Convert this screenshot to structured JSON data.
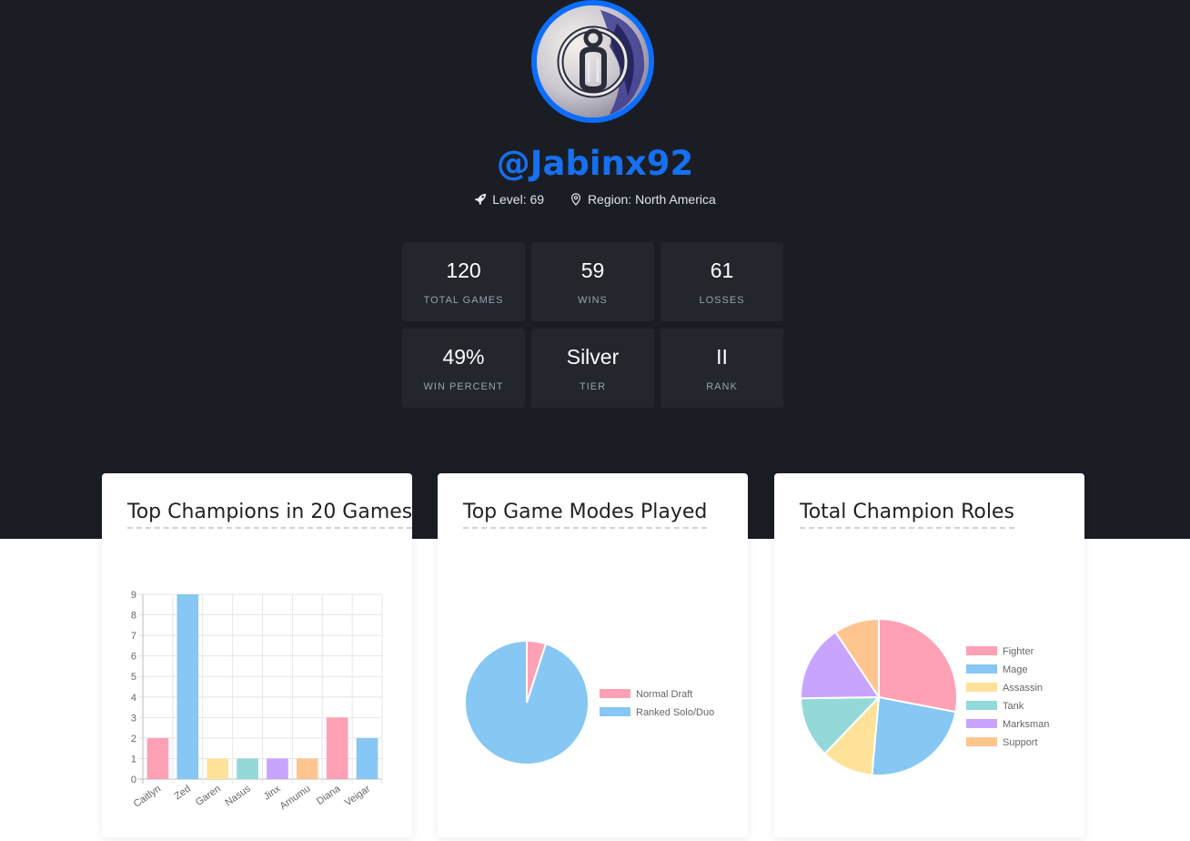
{
  "profile": {
    "username": "@Jabinx92",
    "level_label": "Level: 69",
    "region_label": "Region: North America",
    "avatar_icon": "team-logo-icon"
  },
  "stats": [
    {
      "value": "120",
      "label": "Total Games"
    },
    {
      "value": "59",
      "label": "Wins"
    },
    {
      "value": "61",
      "label": "Losses"
    },
    {
      "value": "49%",
      "label": "Win Percent"
    },
    {
      "value": "Silver",
      "label": "Tier"
    },
    {
      "value": "II",
      "label": "Rank"
    }
  ],
  "cards": {
    "champions_title": "Top Champions in 20 Games",
    "modes_title": "Top Game Modes Played",
    "roles_title": "Total Champion Roles"
  },
  "colors": {
    "accent": "#0d6efd",
    "hero_bg": "#1b1d24",
    "stat_bg": "#23262d"
  },
  "chart_data": [
    {
      "type": "bar",
      "categories": [
        "Caitlyn",
        "Zed",
        "Garen",
        "Nasus",
        "Jinx",
        "Amumu",
        "Diana",
        "Veigar"
      ],
      "values": [
        2,
        9,
        1,
        1,
        1,
        1,
        3,
        2
      ],
      "colors": [
        "#ffa1b5",
        "#86c7f3",
        "#ffe29a",
        "#93d9d9",
        "#c8a4ff",
        "#ffc58f",
        "#ffa1b5",
        "#86c7f3"
      ],
      "ylim": [
        0,
        9
      ],
      "yticks": [
        0,
        1,
        2,
        3,
        4,
        5,
        6,
        7,
        8,
        9
      ],
      "grid": true
    },
    {
      "type": "pie",
      "labels": [
        "Normal Draft",
        "Ranked Solo/Duo"
      ],
      "values": [
        1,
        19
      ],
      "colors": [
        "#ffa1b5",
        "#86c7f3"
      ],
      "legend": "right"
    },
    {
      "type": "pie",
      "labels": [
        "Fighter",
        "Mage",
        "Assassin",
        "Tank",
        "Marksman",
        "Support"
      ],
      "values": [
        6,
        5,
        2.3,
        2.7,
        3.4,
        2
      ],
      "colors": [
        "#ffa1b5",
        "#86c7f3",
        "#ffe29a",
        "#93d9d9",
        "#c8a4ff",
        "#ffc58f"
      ],
      "legend": "right"
    }
  ]
}
